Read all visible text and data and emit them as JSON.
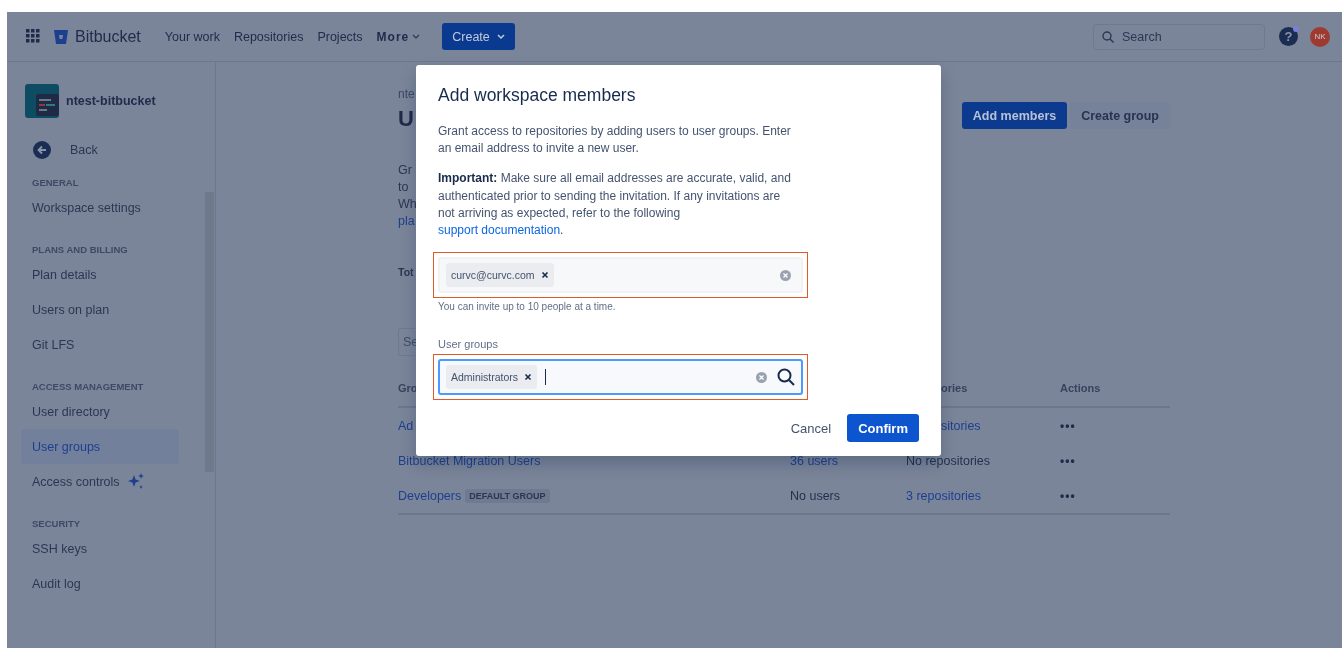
{
  "top_nav": {
    "product": "Bitbucket",
    "links": [
      {
        "label": "Your work"
      },
      {
        "label": "Repositories"
      },
      {
        "label": "Projects"
      }
    ],
    "more": "More",
    "create": "Create",
    "search_placeholder": "Search",
    "help": "?",
    "help_notification": true,
    "avatar": "NK"
  },
  "sidebar": {
    "workspace": "ntest-bitbucket",
    "back": "Back",
    "sections": [
      {
        "heading": "GENERAL",
        "items": [
          {
            "label": "Workspace settings",
            "selected": false,
            "kind": "plain"
          }
        ]
      },
      {
        "heading": "PLANS AND BILLING",
        "items": [
          {
            "label": "Plan details",
            "selected": false,
            "kind": "plain"
          },
          {
            "label": "Users on plan",
            "selected": false,
            "kind": "plain"
          },
          {
            "label": "Git LFS",
            "selected": false,
            "kind": "plain"
          }
        ]
      },
      {
        "heading": "ACCESS MANAGEMENT",
        "items": [
          {
            "label": "User directory",
            "selected": false,
            "kind": "plain"
          },
          {
            "label": "User groups",
            "selected": true,
            "kind": "plain"
          },
          {
            "label": "Access controls",
            "selected": false,
            "kind": "sparkle"
          }
        ]
      },
      {
        "heading": "SECURITY",
        "items": [
          {
            "label": "SSH keys",
            "selected": false,
            "kind": "plain"
          },
          {
            "label": "Audit log",
            "selected": false,
            "kind": "plain"
          }
        ]
      }
    ]
  },
  "page": {
    "breadcrumb": "nte",
    "title": "U",
    "description": [
      "Gr",
      "to",
      "Wh"
    ],
    "description_link": "pla",
    "total": "Tot",
    "search_placeholder": "Se",
    "buttons": [
      {
        "label": "Add members",
        "kind": "primary"
      },
      {
        "label": "Create group",
        "kind": "secondary"
      }
    ],
    "table": {
      "columns": [
        {
          "label": "Gro"
        },
        {
          "label": "ories"
        },
        {
          "label": "Actions"
        }
      ],
      "rows": [
        {
          "group": {
            "text": "Ad",
            "link": true
          },
          "repositories": {
            "text": "sitories",
            "link": true
          },
          "actions": "•••"
        },
        {
          "group": {
            "text": "Bitbucket Migration Users",
            "link": true
          },
          "members": {
            "text": "36 users",
            "link": true
          },
          "repositories": {
            "text": "No repositories",
            "link": false
          },
          "actions": "•••"
        },
        {
          "group": {
            "text": "Developers",
            "link": true
          },
          "tag": "DEFAULT GROUP",
          "members": {
            "text": "No users",
            "link": false
          },
          "repositories": {
            "text": "3 repositories",
            "link": true
          },
          "actions": "•••"
        }
      ]
    }
  },
  "modal": {
    "title": "Add workspace members",
    "intro": "Grant access to repositories by adding users to user groups. Enter an email address to invite a new user.",
    "important": "**Important:** Make sure all email addresses are accurate, valid, and authenticated prior to sending the invitation. If any invitations are not arriving as expected, refer to the following ",
    "link": "support documentation",
    "important_end": ".",
    "email_field": {
      "chips": [
        "curvc@curvc.com"
      ],
      "hint": "You can invite up to 10 people at a time.",
      "focused": false,
      "highlighted": true,
      "search": false
    },
    "groups_field": {
      "label": "User groups",
      "chips": [
        "Administrators"
      ],
      "focused": true,
      "highlighted": true,
      "search": true
    },
    "cancel": "Cancel",
    "confirm": "Confirm"
  }
}
